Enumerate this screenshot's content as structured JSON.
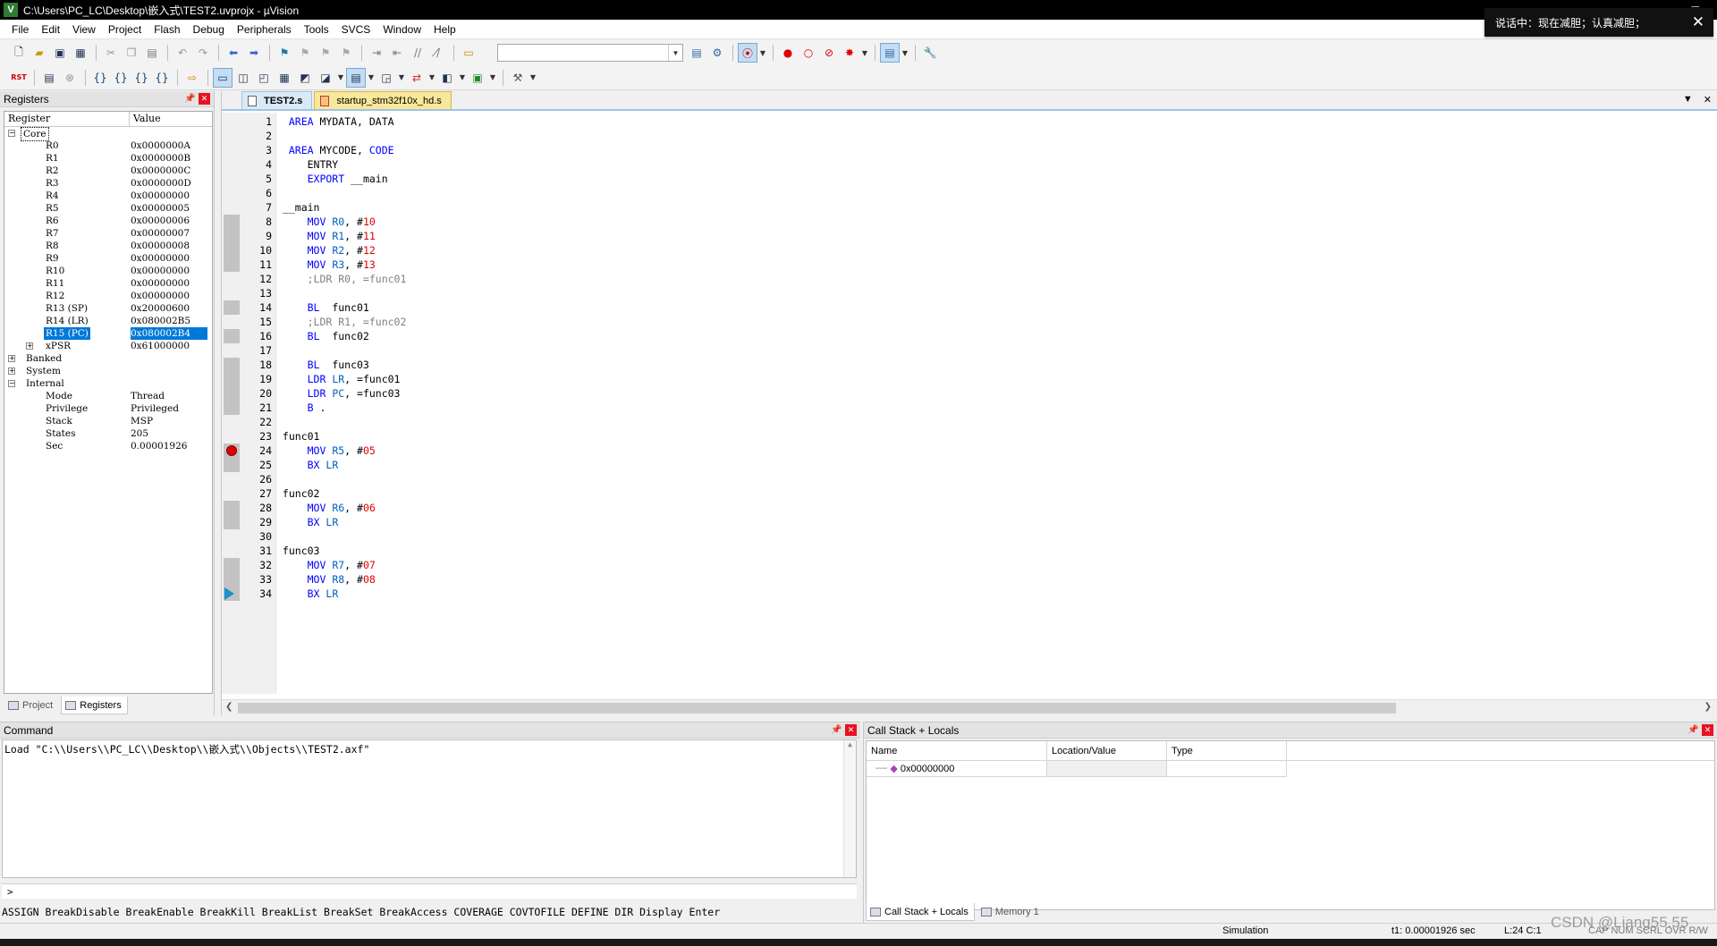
{
  "window": {
    "title": "C:\\Users\\PC_LC\\Desktop\\嵌入式\\TEST2.uvprojx - µVision",
    "app_icon": "V"
  },
  "notification": {
    "text": "说话中：现在减胆；认真减胆；"
  },
  "menu": [
    "File",
    "Edit",
    "View",
    "Project",
    "Flash",
    "Debug",
    "Peripherals",
    "Tools",
    "SVCS",
    "Window",
    "Help"
  ],
  "registers": {
    "title": "Registers",
    "col_register": "Register",
    "col_value": "Value",
    "groups": {
      "core": "Core",
      "banked": "Banked",
      "system": "System",
      "internal": "Internal"
    },
    "core": [
      {
        "name": "R0",
        "value": "0x0000000A"
      },
      {
        "name": "R1",
        "value": "0x0000000B"
      },
      {
        "name": "R2",
        "value": "0x0000000C"
      },
      {
        "name": "R3",
        "value": "0x0000000D"
      },
      {
        "name": "R4",
        "value": "0x00000000"
      },
      {
        "name": "R5",
        "value": "0x00000005"
      },
      {
        "name": "R6",
        "value": "0x00000006"
      },
      {
        "name": "R7",
        "value": "0x00000007"
      },
      {
        "name": "R8",
        "value": "0x00000008"
      },
      {
        "name": "R9",
        "value": "0x00000000"
      },
      {
        "name": "R10",
        "value": "0x00000000"
      },
      {
        "name": "R11",
        "value": "0x00000000"
      },
      {
        "name": "R12",
        "value": "0x00000000"
      },
      {
        "name": "R13 (SP)",
        "value": "0x20000600"
      },
      {
        "name": "R14 (LR)",
        "value": "0x080002B5"
      },
      {
        "name": "R15 (PC)",
        "value": "0x080002B4"
      },
      {
        "name": "xPSR",
        "value": "0x61000000"
      }
    ],
    "internal": [
      {
        "name": "Mode",
        "value": "Thread"
      },
      {
        "name": "Privilege",
        "value": "Privileged"
      },
      {
        "name": "Stack",
        "value": "MSP"
      },
      {
        "name": "States",
        "value": "205"
      },
      {
        "name": "Sec",
        "value": "0.00001926"
      }
    ],
    "tabs": [
      "Project",
      "Registers"
    ]
  },
  "editor": {
    "tabs": [
      "TEST2.s",
      "startup_stm32f10x_hd.s"
    ],
    "lines": [
      {
        "n": "1",
        "t": [
          [
            "kw",
            "  AREA "
          ],
          [
            "p",
            "MYDATA, DATA"
          ]
        ]
      },
      {
        "n": "2",
        "t": []
      },
      {
        "n": "3",
        "t": [
          [
            "kw",
            "  AREA "
          ],
          [
            "p",
            "MYCODE, "
          ],
          [
            "kw",
            "CODE"
          ]
        ]
      },
      {
        "n": "4",
        "t": [
          [
            "p",
            "     ENTRY"
          ]
        ]
      },
      {
        "n": "5",
        "t": [
          [
            "kw",
            "     EXPORT "
          ],
          [
            "p",
            "__main"
          ]
        ]
      },
      {
        "n": "6",
        "t": []
      },
      {
        "n": "7",
        "t": [
          [
            "p",
            " __main"
          ]
        ]
      },
      {
        "n": "8",
        "t": [
          [
            "kw",
            "     MOV "
          ],
          [
            "r",
            "R0"
          ],
          [
            "p",
            ", #"
          ],
          [
            "n",
            "10"
          ]
        ]
      },
      {
        "n": "9",
        "t": [
          [
            "kw",
            "     MOV "
          ],
          [
            "r",
            "R1"
          ],
          [
            "p",
            ", #"
          ],
          [
            "n",
            "11"
          ]
        ]
      },
      {
        "n": "10",
        "t": [
          [
            "kw",
            "     MOV "
          ],
          [
            "r",
            "R2"
          ],
          [
            "p",
            ", #"
          ],
          [
            "n",
            "12"
          ]
        ]
      },
      {
        "n": "11",
        "t": [
          [
            "kw",
            "     MOV "
          ],
          [
            "r",
            "R3"
          ],
          [
            "p",
            ", #"
          ],
          [
            "n",
            "13"
          ]
        ]
      },
      {
        "n": "12",
        "t": [
          [
            "c",
            "     ;LDR R0, =func01"
          ]
        ]
      },
      {
        "n": "13",
        "t": []
      },
      {
        "n": "14",
        "t": [
          [
            "kw",
            "     BL  "
          ],
          [
            "p",
            "func01"
          ]
        ]
      },
      {
        "n": "15",
        "t": [
          [
            "c",
            "     ;LDR R1, =func02"
          ]
        ]
      },
      {
        "n": "16",
        "t": [
          [
            "kw",
            "     BL  "
          ],
          [
            "p",
            "func02"
          ]
        ]
      },
      {
        "n": "17",
        "t": []
      },
      {
        "n": "18",
        "t": [
          [
            "kw",
            "     BL  "
          ],
          [
            "p",
            "func03"
          ]
        ]
      },
      {
        "n": "19",
        "t": [
          [
            "kw",
            "     LDR "
          ],
          [
            "r",
            "LR"
          ],
          [
            "p",
            ", =func01"
          ]
        ]
      },
      {
        "n": "20",
        "t": [
          [
            "kw",
            "     LDR "
          ],
          [
            "r",
            "PC"
          ],
          [
            "p",
            ", =func03"
          ]
        ]
      },
      {
        "n": "21",
        "t": [
          [
            "kw",
            "     B "
          ],
          [
            "p",
            "."
          ]
        ]
      },
      {
        "n": "22",
        "t": []
      },
      {
        "n": "23",
        "t": [
          [
            "p",
            " func01"
          ]
        ]
      },
      {
        "n": "24",
        "t": [
          [
            "kw",
            "     MOV "
          ],
          [
            "r",
            "R5"
          ],
          [
            "p",
            ", #"
          ],
          [
            "n",
            "05"
          ]
        ]
      },
      {
        "n": "25",
        "t": [
          [
            "kw",
            "     BX "
          ],
          [
            "r",
            "LR"
          ]
        ]
      },
      {
        "n": "26",
        "t": []
      },
      {
        "n": "27",
        "t": [
          [
            "p",
            " func02"
          ]
        ]
      },
      {
        "n": "28",
        "t": [
          [
            "kw",
            "     MOV "
          ],
          [
            "r",
            "R6"
          ],
          [
            "p",
            ", #"
          ],
          [
            "n",
            "06"
          ]
        ]
      },
      {
        "n": "29",
        "t": [
          [
            "kw",
            "     BX "
          ],
          [
            "r",
            "LR"
          ]
        ]
      },
      {
        "n": "30",
        "t": []
      },
      {
        "n": "31",
        "t": [
          [
            "p",
            " func03"
          ]
        ]
      },
      {
        "n": "32",
        "t": [
          [
            "kw",
            "     MOV "
          ],
          [
            "r",
            "R7"
          ],
          [
            "p",
            ", #"
          ],
          [
            "n",
            "07"
          ]
        ]
      },
      {
        "n": "33",
        "t": [
          [
            "kw",
            "     MOV "
          ],
          [
            "r",
            "R8"
          ],
          [
            "p",
            ", #"
          ],
          [
            "n",
            "08"
          ]
        ]
      },
      {
        "n": "34",
        "t": [
          [
            "kw",
            "     BX "
          ],
          [
            "r",
            "LR"
          ]
        ]
      }
    ],
    "breakpoint_line": "24",
    "pc_line": "34"
  },
  "command": {
    "title": "Command",
    "output": "Load \"C:\\\\Users\\\\PC_LC\\\\Desktop\\\\嵌入式\\\\Objects\\\\TEST2.axf\"",
    "prompt": ">",
    "hint": "ASSIGN BreakDisable BreakEnable BreakKill BreakList BreakSet BreakAccess COVERAGE COVTOFILE DEFINE DIR Display Enter"
  },
  "callstack": {
    "title": "Call Stack + Locals",
    "col_name": "Name",
    "col_location": "Location/Value",
    "col_type": "Type",
    "row_name": "0x00000000",
    "tabs": [
      "Call Stack + Locals",
      "Memory 1"
    ]
  },
  "status": {
    "mode": "Simulation",
    "time": "t1: 0.00001926 sec",
    "pos": "L:24 C:1",
    "flags": "CAP NUM SCRL OVR R/W"
  },
  "watermark": "CSDN @Liang55.55"
}
